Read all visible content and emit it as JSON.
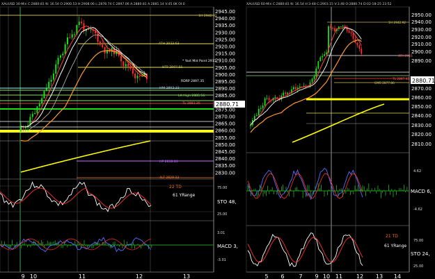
{
  "charts": {
    "left": {
      "header": "XAUUSD 30-Min  C:2880.81  N:  16.54  O:2900.53  H:2908.06  L:2878.74  C:2897.06  A:2880.81  A:2881.14  V:45.0K  OI:0",
      "price_axis": [
        "2945.00",
        "2940.00",
        "2935.00",
        "2930.00",
        "2925.00",
        "2920.00",
        "2915.00",
        "2910.00",
        "2905.00",
        "2900.00",
        "2895.00",
        "2890.00",
        "2885.00",
        "2880.00",
        "2875.00",
        "2870.00",
        "2865.00",
        "2860.00",
        "2855.00",
        "2850.00",
        "2845.00",
        "2840.00",
        "2835.00",
        "2830.00"
      ],
      "last_price": "2880.71",
      "x_axis": [
        "9",
        "10",
        "11",
        "12",
        "13"
      ],
      "annotations": [
        {
          "text": "1H 2942.92",
          "color": "#d4c75a"
        },
        {
          "text": "ATH 2923.63",
          "color": "#d4c75a"
        },
        {
          "text": "* Yast Mid Point 2911",
          "color": "#ffffff"
        },
        {
          "text": "HTF 2907.55",
          "color": "#d4c75a"
        },
        {
          "text": "RDRP 2897.35",
          "color": "#ffffff"
        },
        {
          "text": "HNI 2892.33",
          "color": "#c0c0c0"
        },
        {
          "text": "LA High 2885.56",
          "color": "#8fdc6a"
        },
        {
          "text": "TL 2881.35",
          "color": "#ff6060"
        },
        {
          "text": "HP 2838.83",
          "color": "#c070ff"
        },
        {
          "text": "ALT 2829.33",
          "color": "#ff7a2a"
        }
      ],
      "stoch": {
        "label": "STO  48,",
        "td": "22 TD",
        "yrange": "61 YRange",
        "levels": [
          "75.00",
          "25.00"
        ]
      },
      "macd": {
        "label": "MACD  3,",
        "levels": [
          "3.01",
          "-3.01"
        ]
      }
    },
    "right": {
      "header": "XAUUSD 60-Min  C:2880.81  N:  16.54  H:3-48  C:2903.15  V:3.48  O:2880.74  D:02-18-25  23:52",
      "price_axis": [
        "2950.00",
        "2940.00",
        "2930.00",
        "2920.00",
        "2910.00",
        "2900.00",
        "2890.00",
        "2880.71",
        "2870.00",
        "2860.00",
        "2850.00",
        "2840.00",
        "2830.00",
        "2820.00",
        "2810.00"
      ],
      "last_price": "2880.71",
      "x_axis": [
        "5",
        "6",
        "7",
        "9",
        "10",
        "11",
        "12",
        "13",
        "14"
      ],
      "annotations": [
        {
          "text": "1H 2942.92",
          "color": "#d4c75a"
        },
        {
          "text": "ATH 2916",
          "color": "#ff6060"
        },
        {
          "text": "TL 2887.43",
          "color": "#ff6060"
        },
        {
          "text": "GMS 2877.86",
          "color": "#d4c75a"
        }
      ],
      "macd": {
        "label": "MACD  6,",
        "levels": [
          "4.62",
          "-4.62"
        ]
      },
      "stoch": {
        "label": "STO  24,",
        "td": "21 TD",
        "yrange": "61 YRange",
        "levels": [
          "75.00",
          "25.00"
        ]
      }
    }
  }
}
